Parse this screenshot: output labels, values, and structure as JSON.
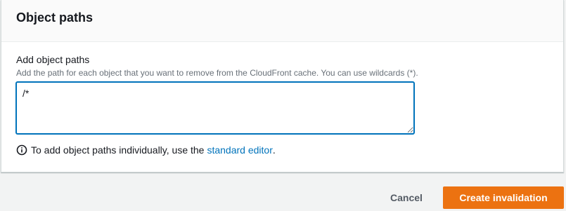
{
  "panel": {
    "title": "Object paths"
  },
  "field": {
    "label": "Add object paths",
    "description": "Add the path for each object that you want to remove from the CloudFront cache. You can use wildcards (*).",
    "value": "/*"
  },
  "info": {
    "text": "To add object paths individually, use the",
    "link_label": "standard editor",
    "suffix": ".",
    "icon": "info-icon"
  },
  "actions": {
    "cancel_label": "Cancel",
    "create_label": "Create invalidation"
  },
  "colors": {
    "primary_button": "#ec7211",
    "link": "#0073bb",
    "focus_border": "#0073bb"
  }
}
